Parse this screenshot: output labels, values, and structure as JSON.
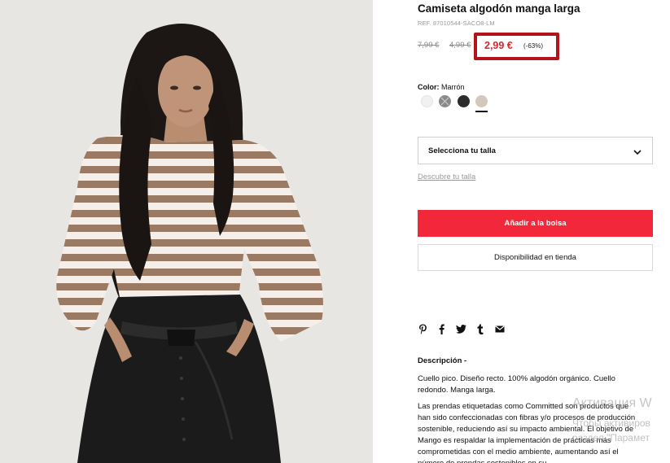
{
  "product": {
    "title": "Camiseta algodón manga larga",
    "ref": "REF. 87010544-SACO8-LM"
  },
  "prices": {
    "original": "7,99 €",
    "previous": "4,99 €",
    "current": "2,99 €",
    "discount": "(-63%)"
  },
  "colors": {
    "label": "Color:",
    "selected": "Marrón",
    "swatches": [
      "#f1f1f1",
      "#8a8a8a",
      "#2b2b2b",
      "#d4c8bc"
    ]
  },
  "size": {
    "placeholder": "Selecciona tu talla",
    "guide_link": "Descubre tu talla"
  },
  "actions": {
    "add_to_bag": "Añadir a la bolsa",
    "store_availability": "Disponibilidad en tienda"
  },
  "share_icons": [
    "pinterest-icon",
    "facebook-icon",
    "twitter-icon",
    "tumblr-icon",
    "mail-icon"
  ],
  "description": {
    "title": "Descripción -",
    "text": "Cuello pico. Diseño recto. 100% algodón orgánico. Cuello redondo. Manga larga.",
    "sustainability": "Las prendas etiquetadas como Committed son productos que han sido confeccionadas con fibras y/o procesos de producción sostenible, reduciendo así su impacto ambiental. El objetivo de Mango es respaldar la implementación de prácticas más comprometidas con el medio ambiente, aumentando así el número de prendas sostenibles en su"
  },
  "watermark": {
    "title": "Активация W",
    "line1": "Чтобы активиров",
    "line2": "раздел \"Парамет"
  },
  "theme": {
    "accent": "#f2283a",
    "price_red": "#d7282f",
    "highlight_box": "#b3141c"
  }
}
